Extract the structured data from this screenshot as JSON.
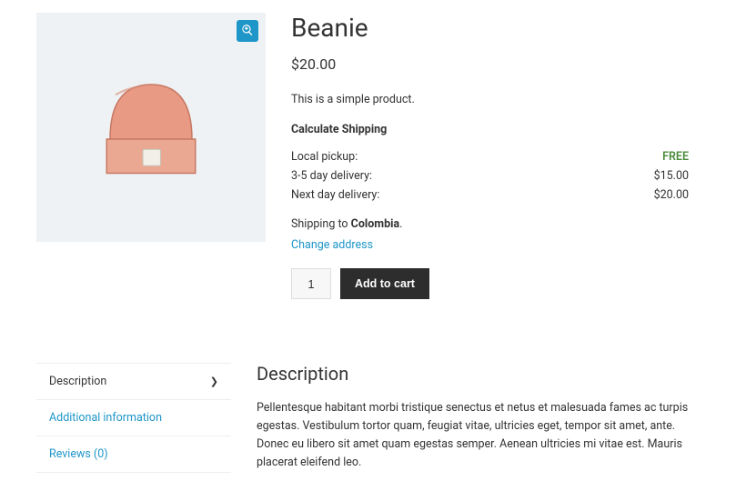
{
  "product": {
    "title": "Beanie",
    "price": "$20.00",
    "short_description": "This is a simple product."
  },
  "shipping": {
    "heading": "Calculate Shipping",
    "rows": [
      {
        "label": "Local pickup:",
        "cost": "FREE",
        "free": true
      },
      {
        "label": "3-5 day delivery:",
        "cost": "$15.00",
        "free": false
      },
      {
        "label": "Next day delivery:",
        "cost": "$20.00",
        "free": false
      }
    ],
    "note_prefix": "Shipping to ",
    "note_country": "Colombia",
    "note_suffix": ".",
    "change_label": "Change address"
  },
  "cart": {
    "quantity": "1",
    "add_label": "Add to cart"
  },
  "tabs": {
    "items": [
      {
        "label": "Description",
        "active": true
      },
      {
        "label": "Additional information",
        "active": false
      },
      {
        "label": "Reviews (0)",
        "active": false
      }
    ]
  },
  "description": {
    "title": "Description",
    "body": "Pellentesque habitant morbi tristique senectus et netus et malesuada fames ac turpis egestas. Vestibulum tortor quam, feugiat vitae, ultricies eget, tempor sit amet, ante. Donec eu libero sit amet quam egestas semper. Aenean ultricies mi vitae est. Mauris placerat eleifend leo."
  }
}
